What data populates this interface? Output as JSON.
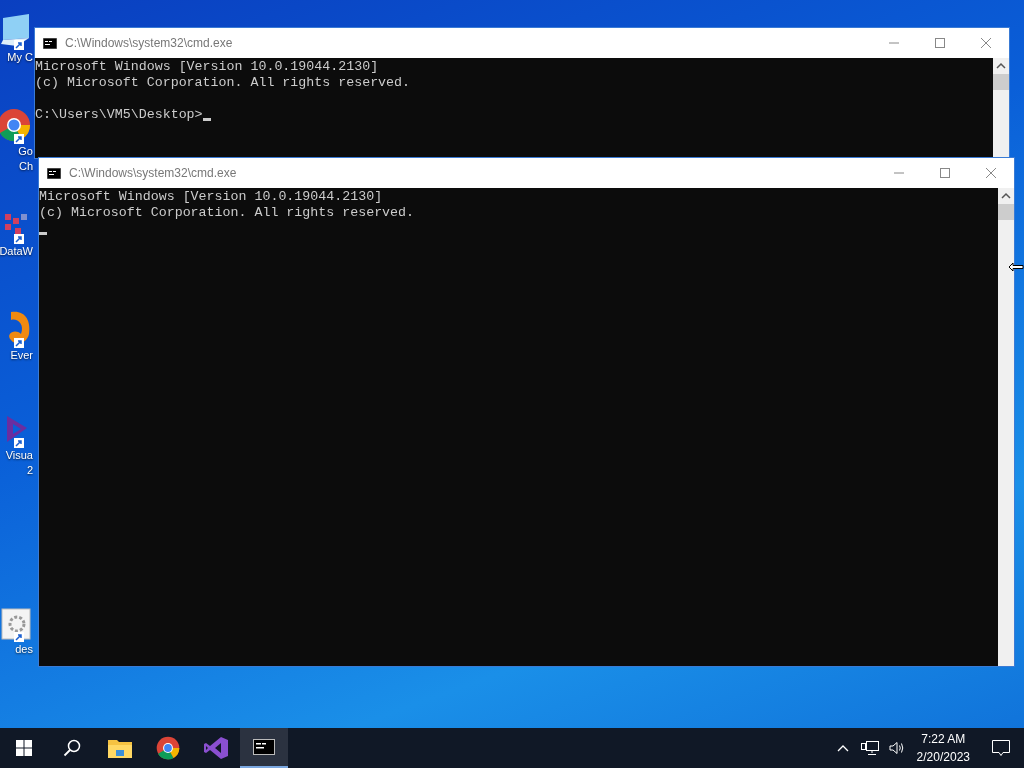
{
  "desktop_icons": [
    {
      "kind": "computer",
      "lines": [
        "My C"
      ]
    },
    {
      "kind": "chrome",
      "lines": [
        "Go",
        "Ch"
      ]
    },
    {
      "kind": "datawindow",
      "lines": [
        "DataW"
      ]
    },
    {
      "kind": "evernote",
      "lines": [
        "Ever"
      ]
    },
    {
      "kind": "visualstudio",
      "lines": [
        "Visua",
        "2"
      ]
    },
    {
      "kind": "settings",
      "lines": [
        "des"
      ]
    }
  ],
  "windows": [
    {
      "title": "C:\\Windows\\system32\\cmd.exe",
      "lines": [
        "Microsoft Windows [Version 10.0.19044.2130]",
        "(c) Microsoft Corporation. All rights reserved."
      ],
      "prompt": "C:\\Users\\VM5\\Desktop>"
    },
    {
      "title": "C:\\Windows\\system32\\cmd.exe",
      "lines": [
        "Microsoft Windows [Version 10.0.19044.2130]",
        "(c) Microsoft Corporation. All rights reserved."
      ]
    }
  ],
  "taskbar": {
    "apps": [
      {
        "kind": "start",
        "selected": false
      },
      {
        "kind": "search",
        "selected": false
      },
      {
        "kind": "explorer",
        "selected": false
      },
      {
        "kind": "chrome",
        "selected": false
      },
      {
        "kind": "visualstudio",
        "selected": false
      },
      {
        "kind": "cmd",
        "selected": true
      }
    ],
    "time": "7:22 AM",
    "date": "2/20/2023"
  }
}
